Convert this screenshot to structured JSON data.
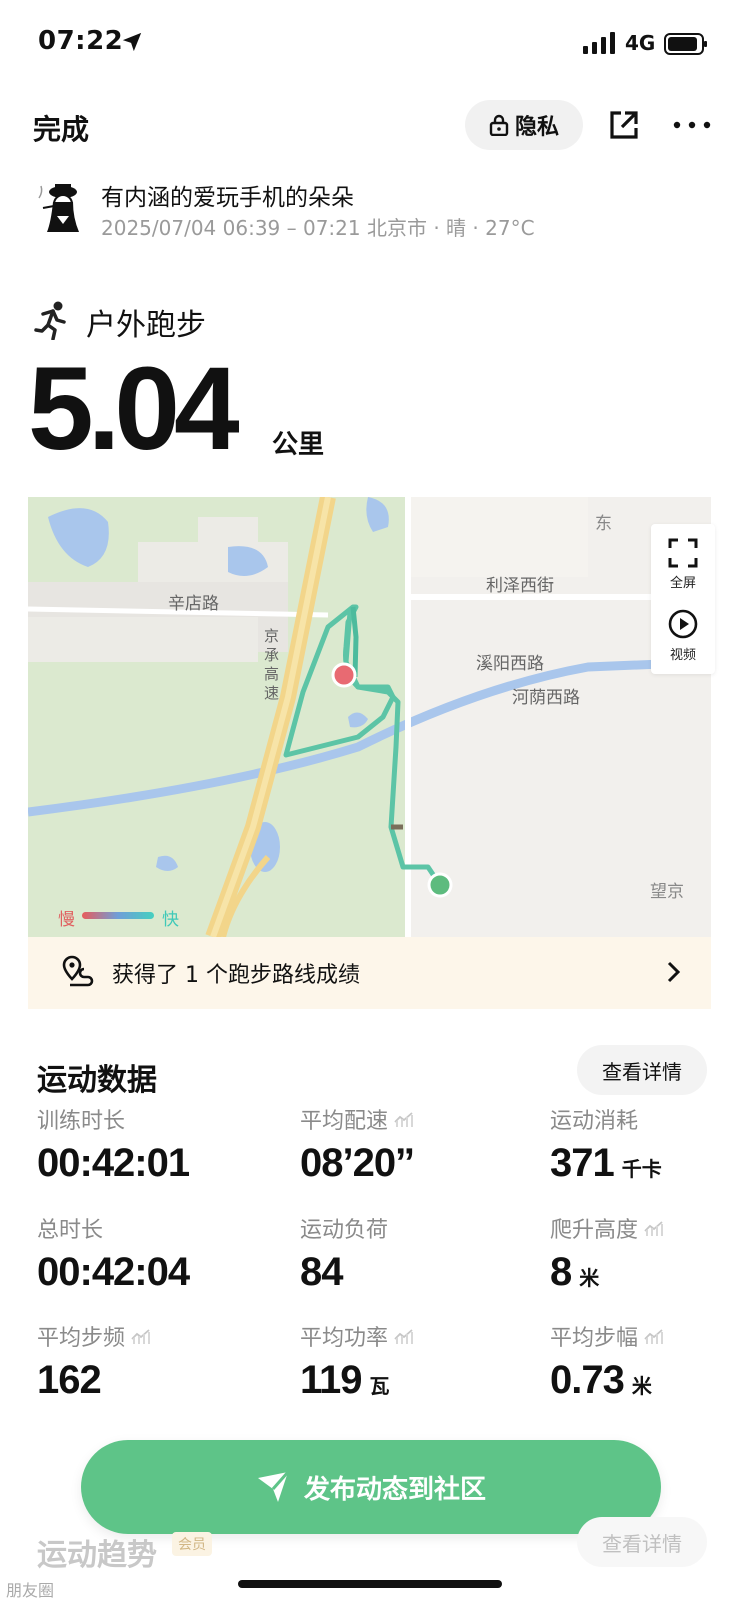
{
  "status_bar": {
    "time": "07:22",
    "network": "4G"
  },
  "header": {
    "done_label": "完成",
    "privacy_label": "隐私"
  },
  "user": {
    "name": "有内涵的爱玩手机的朵朵",
    "meta": "2025/07/04 06:39 – 07:21 北京市 · 晴 · 27°C"
  },
  "activity": {
    "type": "户外跑步",
    "distance": "5.04",
    "distance_unit": "公里"
  },
  "map": {
    "labels": {
      "xindian_road": "辛店路",
      "lize_west_street": "利泽西街",
      "xiyang_west_road": "溪阳西路",
      "heyin_west_road": "河荫西路",
      "jingcheng_expressway": "京承高速",
      "dong": "东",
      "wangjing": "望京"
    },
    "controls": {
      "fullscreen": "全屏",
      "video": "视频"
    },
    "legend": {
      "slow": "慢",
      "fast": "快"
    },
    "colors": {
      "route": "#5cc4a6",
      "start": "#e86a72",
      "end": "#5dbb7e",
      "river": "#a9c6ec"
    }
  },
  "achievement": {
    "text": "获得了 1 个跑步路线成绩"
  },
  "sports_data": {
    "title": "运动数据",
    "detail_label": "查看详情",
    "metrics": [
      {
        "label": "训练时长",
        "value": "00:42:01",
        "unit": ""
      },
      {
        "label": "平均配速",
        "value": "08’20’’",
        "unit": ""
      },
      {
        "label": "运动消耗",
        "value": "371",
        "unit": "千卡"
      },
      {
        "label": "总时长",
        "value": "00:42:04",
        "unit": ""
      },
      {
        "label": "运动负荷",
        "value": "84",
        "unit": ""
      },
      {
        "label": "爬升高度",
        "value": "8",
        "unit": "米"
      },
      {
        "label": "平均步频",
        "value": "162",
        "unit": ""
      },
      {
        "label": "平均功率",
        "value": "119",
        "unit": "瓦"
      },
      {
        "label": "平均步幅",
        "value": "0.73",
        "unit": "米"
      }
    ]
  },
  "publish": {
    "label": "发布动态到社区"
  },
  "trend": {
    "title": "运动趋势",
    "member_tag": "会员",
    "detail_label": "查看详情"
  },
  "watermark": "朋友圈"
}
